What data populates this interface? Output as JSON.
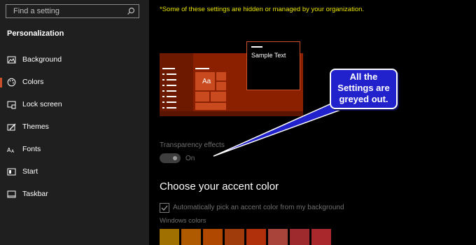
{
  "search": {
    "placeholder": "Find a setting",
    "icon": "search-icon"
  },
  "sidebar": {
    "section_title": "Personalization",
    "items": [
      {
        "label": "Background",
        "icon": "image-icon"
      },
      {
        "label": "Colors",
        "icon": "palette-icon",
        "selected": true
      },
      {
        "label": "Lock screen",
        "icon": "lock-screen-icon"
      },
      {
        "label": "Themes",
        "icon": "themes-icon"
      },
      {
        "label": "Fonts",
        "icon": "fonts-icon"
      },
      {
        "label": "Start",
        "icon": "start-icon"
      },
      {
        "label": "Taskbar",
        "icon": "taskbar-icon"
      }
    ]
  },
  "main": {
    "notice": "*Some of these settings are hidden or managed by your organization.",
    "preview": {
      "tile_text": "Aa",
      "sample_text": "Sample Text"
    },
    "callout": "All the\nSettings are\ngreyed out.",
    "transparency": {
      "label": "Transparency effects",
      "state": "On"
    },
    "accent_heading": "Choose your accent color",
    "auto_pick_label": "Automatically pick an accent color from my background",
    "windows_colors_label": "Windows colors",
    "swatches": [
      "#a07000",
      "#b05a00",
      "#b04800",
      "#a03c0c",
      "#b0300c",
      "#a8443a",
      "#9e2a2e",
      "#a8282c"
    ]
  },
  "colors": {
    "accent": "#c9502a",
    "notice": "#e6e000",
    "callout": "#2222cc"
  }
}
